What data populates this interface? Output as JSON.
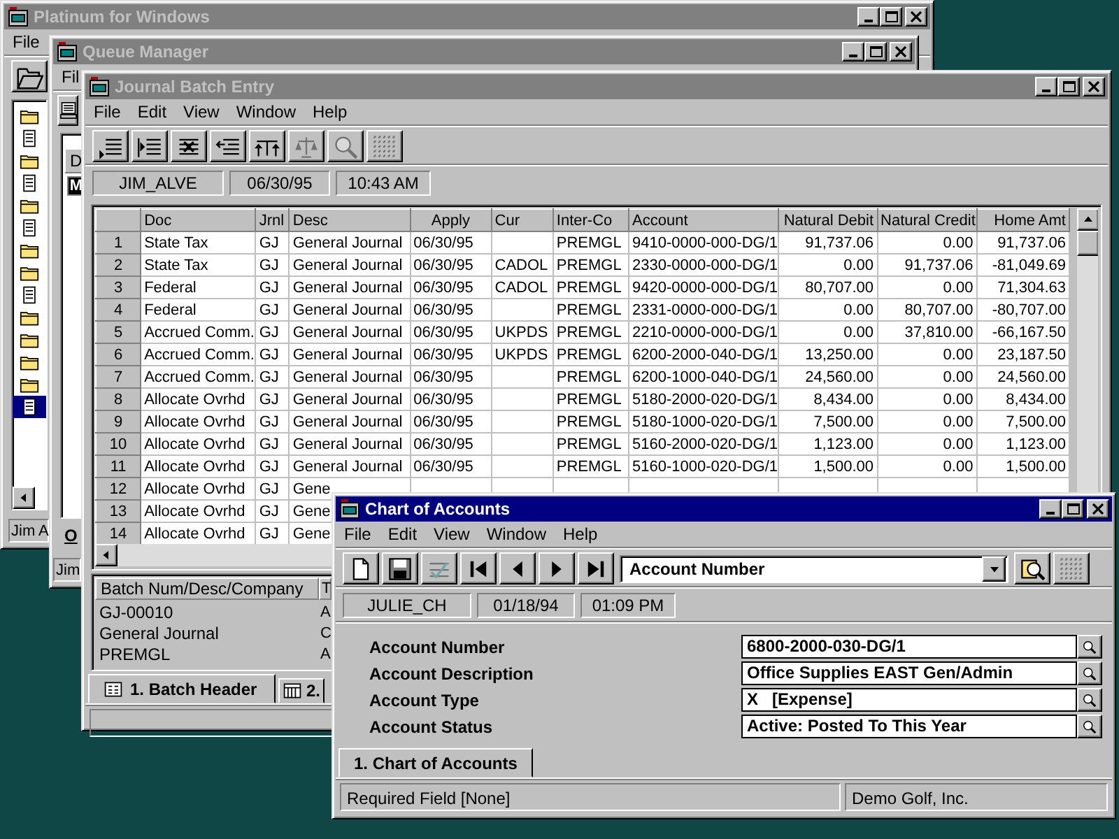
{
  "platinum_window": {
    "title": "Platinum for Windows",
    "active": false,
    "menu": [
      "File"
    ],
    "list_items": [
      {
        "kind": "folder",
        "selected": false
      },
      {
        "kind": "doc",
        "selected": false
      },
      {
        "kind": "folder",
        "selected": false
      },
      {
        "kind": "doc",
        "selected": false
      },
      {
        "kind": "folder",
        "selected": false
      },
      {
        "kind": "doc",
        "selected": false
      },
      {
        "kind": "folder",
        "selected": false
      },
      {
        "kind": "folder",
        "selected": false
      },
      {
        "kind": "doc",
        "selected": false
      },
      {
        "kind": "folder",
        "selected": false
      },
      {
        "kind": "folder",
        "selected": false
      },
      {
        "kind": "folder",
        "selected": false
      },
      {
        "kind": "folder",
        "selected": false
      },
      {
        "kind": "doc",
        "selected": true
      }
    ],
    "status": "Jim A"
  },
  "queue_window": {
    "title": "Queue Manager",
    "active": false,
    "menu": [
      "Fil"
    ],
    "list_header": "D",
    "list_badge": "M",
    "tab_label": "O",
    "status": "Jim"
  },
  "journal_window": {
    "title": "Journal Batch Entry",
    "active": false,
    "menu": [
      "File",
      "Edit",
      "View",
      "Window",
      "Help"
    ],
    "toolbar": [
      {
        "kind": "append",
        "disabled": false
      },
      {
        "kind": "insert",
        "disabled": false
      },
      {
        "kind": "delete",
        "disabled": false
      },
      {
        "kind": "outdent",
        "disabled": false
      },
      {
        "kind": "transfer",
        "disabled": false
      },
      {
        "kind": "balance",
        "disabled": true
      },
      {
        "kind": "find",
        "disabled": true
      },
      {
        "kind": "grid",
        "disabled": true
      }
    ],
    "info": [
      "JIM_ALVE",
      "06/30/95",
      "10:43 AM"
    ],
    "table": {
      "columns": [
        {
          "label": "Doc",
          "kind": "text"
        },
        {
          "label": "Jrnl",
          "kind": "text"
        },
        {
          "label": "Desc",
          "kind": "text"
        },
        {
          "label": "Apply",
          "kind": "date"
        },
        {
          "label": "Cur",
          "kind": "text"
        },
        {
          "label": "Inter-Co",
          "kind": "text"
        },
        {
          "label": "Account",
          "kind": "text"
        },
        {
          "label": "Natural Debit",
          "kind": "number"
        },
        {
          "label": "Natural Credit",
          "kind": "number"
        },
        {
          "label": "Home Amt",
          "kind": "number"
        }
      ],
      "rows": [
        {
          "num": "1",
          "cells": [
            "State Tax",
            "GJ",
            "General Journal",
            "06/30/95",
            null,
            "PREMGL",
            "9410-0000-000-DG/1",
            "91,737.06",
            "0.00",
            "91,737.06"
          ]
        },
        {
          "num": "2",
          "cells": [
            "State Tax",
            "GJ",
            "General Journal",
            "06/30/95",
            "CADOL",
            "PREMGL",
            "2330-0000-000-DG/1",
            "0.00",
            "91,737.06",
            "-81,049.69"
          ]
        },
        {
          "num": "3",
          "cells": [
            "Federal",
            "GJ",
            "General Journal",
            "06/30/95",
            "CADOL",
            "PREMGL",
            "9420-0000-000-DG/1",
            "80,707.00",
            "0.00",
            "71,304.63"
          ]
        },
        {
          "num": "4",
          "cells": [
            "Federal",
            "GJ",
            "General Journal",
            "06/30/95",
            null,
            "PREMGL",
            "2331-0000-000-DG/1",
            "0.00",
            "80,707.00",
            "-80,707.00"
          ]
        },
        {
          "num": "5",
          "cells": [
            "Accrued Comm.",
            "GJ",
            "General Journal",
            "06/30/95",
            "UKPDS",
            "PREMGL",
            "2210-0000-000-DG/1",
            "0.00",
            "37,810.00",
            "-66,167.50"
          ]
        },
        {
          "num": "6",
          "cells": [
            "Accrued Comm.",
            "GJ",
            "General Journal",
            "06/30/95",
            "UKPDS",
            "PREMGL",
            "6200-2000-040-DG/1",
            "13,250.00",
            "0.00",
            "23,187.50"
          ]
        },
        {
          "num": "7",
          "cells": [
            "Accrued Comm.",
            "GJ",
            "General Journal",
            "06/30/95",
            null,
            "PREMGL",
            "6200-1000-040-DG/1",
            "24,560.00",
            "0.00",
            "24,560.00"
          ]
        },
        {
          "num": "8",
          "cells": [
            "Allocate Ovrhd",
            "GJ",
            "General Journal",
            "06/30/95",
            null,
            "PREMGL",
            "5180-2000-020-DG/1",
            "8,434.00",
            "0.00",
            "8,434.00"
          ]
        },
        {
          "num": "9",
          "cells": [
            "Allocate Ovrhd",
            "GJ",
            "General Journal",
            "06/30/95",
            null,
            "PREMGL",
            "5180-1000-020-DG/1",
            "7,500.00",
            "0.00",
            "7,500.00"
          ]
        },
        {
          "num": "10",
          "cells": [
            "Allocate Ovrhd",
            "GJ",
            "General Journal",
            "06/30/95",
            null,
            "PREMGL",
            "5160-2000-020-DG/1",
            "1,123.00",
            "0.00",
            "1,123.00"
          ]
        },
        {
          "num": "11",
          "cells": [
            "Allocate Ovrhd",
            "GJ",
            "General Journal",
            "06/30/95",
            null,
            "PREMGL",
            "5160-1000-020-DG/1",
            "1,500.00",
            "0.00",
            "1,500.00"
          ]
        },
        {
          "num": "12",
          "cells": [
            "Allocate Ovrhd",
            "GJ",
            "Gene"
          ]
        },
        {
          "num": "13",
          "cells": [
            "Allocate Ovrhd",
            "GJ",
            "Gene"
          ]
        },
        {
          "num": "14",
          "cells": [
            "Allocate Ovrhd",
            "GJ",
            "Gene"
          ]
        }
      ]
    },
    "header_panel": [
      {
        "header": "Batch Num/Desc/Company",
        "lines": [
          "GJ-00010",
          "General Journal",
          "PREMGL"
        ]
      },
      {
        "header": "T",
        "lines": [
          "A",
          "C",
          "A"
        ]
      }
    ],
    "tabs": [
      {
        "label": "1. Batch Header",
        "kind": "form",
        "selected": true
      },
      {
        "label": "2.",
        "kind": "grid",
        "selected": false
      }
    ]
  },
  "accounts_window": {
    "title": "Chart of Accounts",
    "active": true,
    "menu": [
      "File",
      "Edit",
      "View",
      "Window",
      "Help"
    ],
    "toolbar": [
      {
        "kind": "new",
        "disabled": false
      },
      {
        "kind": "save",
        "disabled": false
      },
      {
        "kind": "edit",
        "disabled": true
      },
      {
        "kind": "first",
        "disabled": false
      },
      {
        "kind": "prev",
        "disabled": false
      },
      {
        "kind": "next",
        "disabled": false
      },
      {
        "kind": "last",
        "disabled": false
      },
      {
        "kind": "combo",
        "value": "Account Number"
      },
      {
        "kind": "lookup",
        "disabled": false
      },
      {
        "kind": "grid",
        "disabled": true
      }
    ],
    "info": [
      "JULIE_CH",
      "01/18/94",
      "01:09 PM"
    ],
    "fields": [
      {
        "label": "Account Number",
        "value": "6800-2000-030-DG/1"
      },
      {
        "label": "Account Description",
        "value": "Office Supplies EAST Gen/Admin"
      },
      {
        "label": "Account Type",
        "value": "X   [Expense]"
      },
      {
        "label": "Account Status",
        "value": "Active: Posted To This Year"
      }
    ],
    "tabs": [
      {
        "label": "1. Chart of Accounts",
        "selected": true
      }
    ],
    "status_bar": [
      "Required Field [None]",
      "Demo Golf, Inc."
    ]
  }
}
